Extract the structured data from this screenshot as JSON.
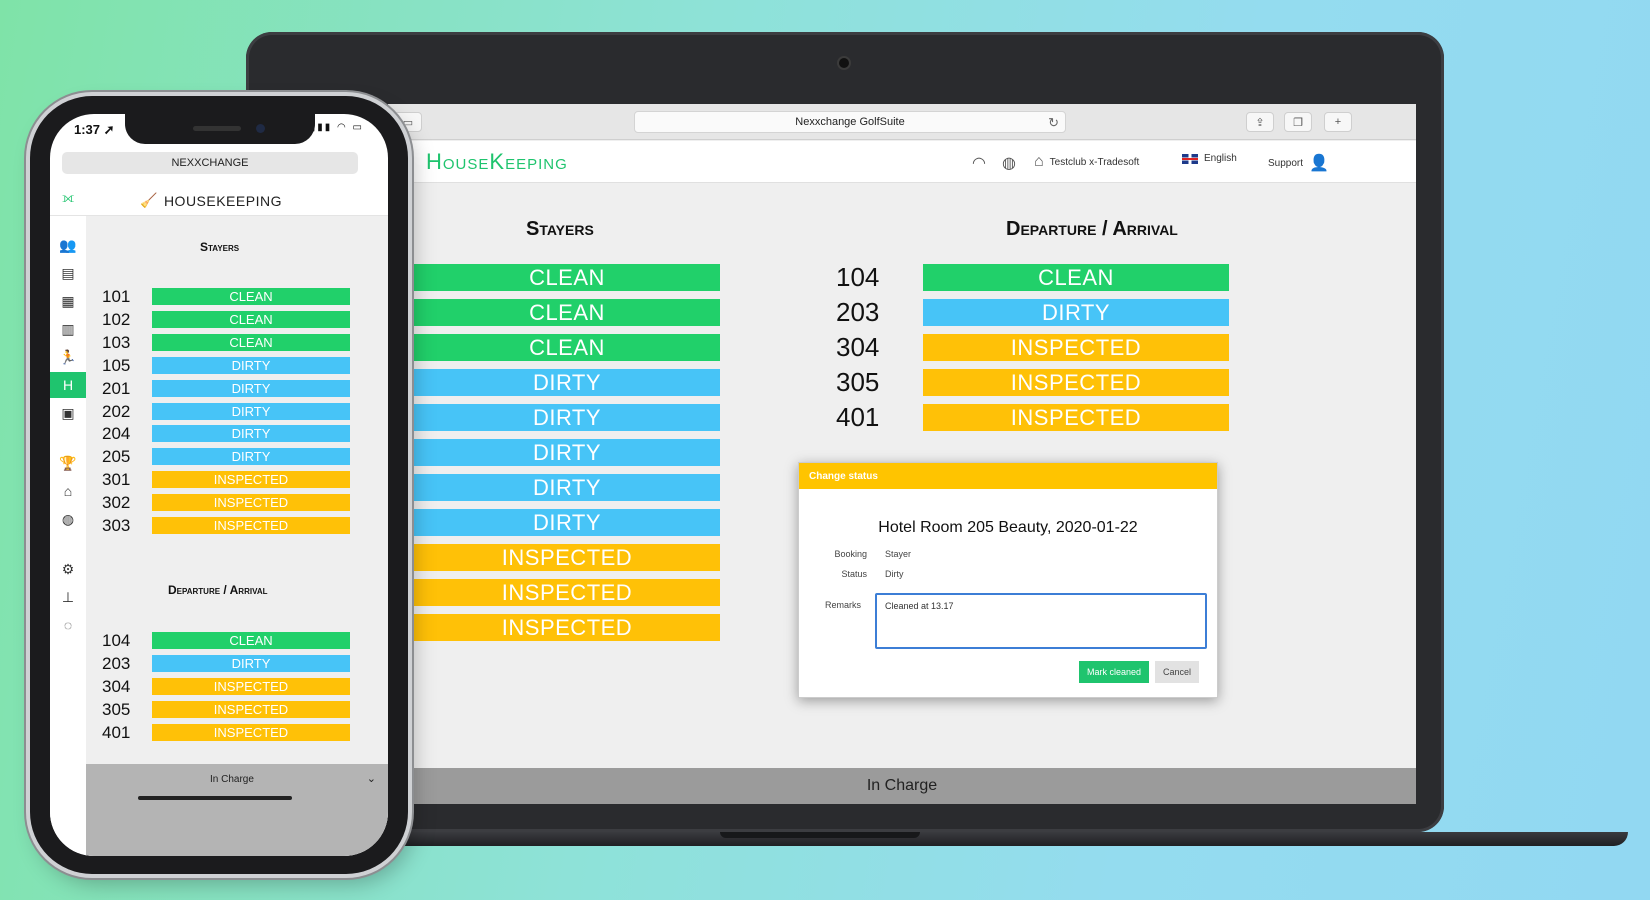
{
  "colors": {
    "clean": "#21d06a",
    "dirty": "#47c4f7",
    "inspected": "#ffc107",
    "brand": "#1fc46e",
    "dialog_header": "#ffc400"
  },
  "desktop": {
    "browser": {
      "url": "Nexxchange GolfSuite"
    },
    "header": {
      "app_title": "HouseKeeping",
      "club": "Testclub x-Tradesoft",
      "language": "English",
      "support": "Support"
    },
    "stayers": {
      "title": "Stayers",
      "statuses": [
        "CLEAN",
        "CLEAN",
        "CLEAN",
        "DIRTY",
        "DIRTY",
        "DIRTY",
        "DIRTY",
        "DIRTY",
        "INSPECTED",
        "INSPECTED",
        "INSPECTED"
      ]
    },
    "departure_arrival": {
      "title": "Departure / Arrival",
      "rooms": [
        {
          "room": "104",
          "status": "CLEAN"
        },
        {
          "room": "203",
          "status": "DIRTY"
        },
        {
          "room": "304",
          "status": "INSPECTED"
        },
        {
          "room": "305",
          "status": "INSPECTED"
        },
        {
          "room": "401",
          "status": "INSPECTED"
        }
      ]
    },
    "dialog": {
      "header": "Change status",
      "title": "Hotel Room 205 Beauty, 2020-01-22",
      "booking_label": "Booking",
      "booking_value": "Stayer",
      "status_label": "Status",
      "status_value": "Dirty",
      "remarks_label": "Remarks",
      "remarks_value": "Cleaned at 13.17",
      "confirm_label": "Mark cleaned",
      "cancel_label": "Cancel"
    },
    "footer": "In Charge"
  },
  "phone": {
    "time": "1:37",
    "url": "NEXXCHANGE",
    "title": "HOUSEKEEPING",
    "stayers": {
      "title": "Stayers",
      "rooms": [
        {
          "room": "101",
          "status": "CLEAN"
        },
        {
          "room": "102",
          "status": "CLEAN"
        },
        {
          "room": "103",
          "status": "CLEAN"
        },
        {
          "room": "105",
          "status": "DIRTY"
        },
        {
          "room": "201",
          "status": "DIRTY"
        },
        {
          "room": "202",
          "status": "DIRTY"
        },
        {
          "room": "204",
          "status": "DIRTY"
        },
        {
          "room": "205",
          "status": "DIRTY"
        },
        {
          "room": "301",
          "status": "INSPECTED"
        },
        {
          "room": "302",
          "status": "INSPECTED"
        },
        {
          "room": "303",
          "status": "INSPECTED"
        }
      ]
    },
    "departure_arrival": {
      "title": "Departure / Arrival",
      "rooms": [
        {
          "room": "104",
          "status": "CLEAN"
        },
        {
          "room": "203",
          "status": "DIRTY"
        },
        {
          "room": "304",
          "status": "INSPECTED"
        },
        {
          "room": "305",
          "status": "INSPECTED"
        },
        {
          "room": "401",
          "status": "INSPECTED"
        }
      ]
    },
    "footer": "In Charge",
    "sidebar_icons": [
      "users-icon",
      "document-icon",
      "cash-register-icon",
      "barcode-icon",
      "runner-icon",
      "hotel-icon",
      "calendar-icon",
      "trophy-icon",
      "home-icon",
      "globe-icon",
      "settings-icon",
      "org-chart-icon",
      "chat-icon"
    ]
  }
}
